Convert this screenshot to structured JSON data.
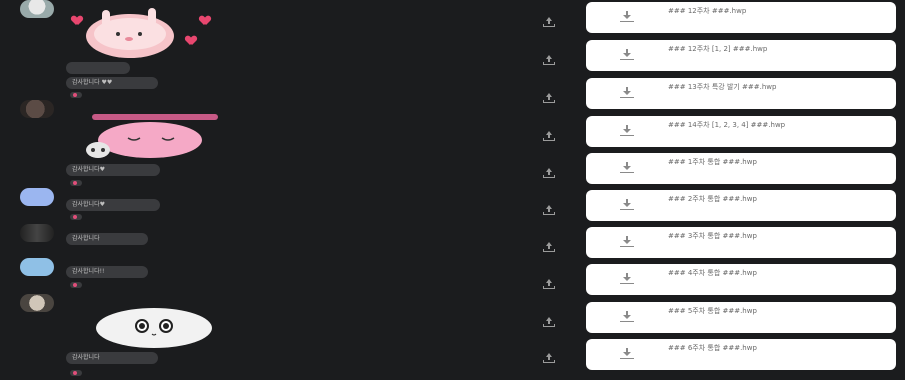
{
  "messages": [
    {
      "avatar": "a1",
      "sender": "",
      "bubbles": [
        "",
        "감사합니다 ♥♥"
      ],
      "sticker": "pink-bunny",
      "react": true
    },
    {
      "avatar": "a2",
      "sender": "",
      "bubbles": [
        "감사합니다♥"
      ],
      "sticker": "pink-bunny-crying",
      "react": true
    },
    {
      "avatar": "a3",
      "sender": "",
      "bubbles": [
        "감사합니다♥"
      ],
      "sticker": "",
      "react": true
    },
    {
      "avatar": "a4",
      "sender": "",
      "bubbles": [
        "감사합니다"
      ],
      "sticker": "",
      "react": false
    },
    {
      "avatar": "a5",
      "sender": "",
      "bubbles": [
        "감사합니다!!"
      ],
      "sticker": "",
      "react": true
    },
    {
      "avatar": "a6",
      "sender": "",
      "bubbles": [
        "감사합니다"
      ],
      "sticker": "white-cat",
      "react": true
    }
  ],
  "files": [
    {
      "name": "### 12주차 ###.hwp"
    },
    {
      "name": "### 12주차 [1, 2] ###.hwp"
    },
    {
      "name": "### 13주차 특강 발기 ###.hwp"
    },
    {
      "name": "### 14주차 [1, 2, 3, 4] ###.hwp"
    },
    {
      "name": "### 1주차 통합 ###.hwp"
    },
    {
      "name": "### 2주차 통합 ###.hwp"
    },
    {
      "name": "### 3주차 통합 ###.hwp"
    },
    {
      "name": "### 4주차 통합 ###.hwp"
    },
    {
      "name": "### 5주차 통합 ###.hwp"
    },
    {
      "name": "### 6주차 통합 ###.hwp"
    }
  ]
}
